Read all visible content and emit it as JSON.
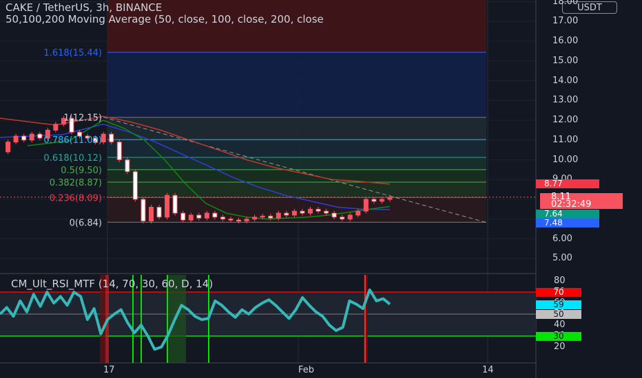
{
  "header": {
    "symbol_line": "CAKE / TetherUS, 3h, BINANCE",
    "indicator_line": "50,100,200 Moving Average (50, close, 100, close, 200, close"
  },
  "currency_button": "USDT",
  "price_axis": {
    "labels": [
      "18.00",
      "17.00",
      "16.00",
      "15.00",
      "14.00",
      "13.00",
      "12.00",
      "11.00",
      "10.00",
      "9.00",
      "8.00",
      "7.00",
      "6.00",
      "5.00"
    ],
    "tags": [
      {
        "text": "8.77",
        "bg": "#f23645",
        "color": "#ffffff"
      },
      {
        "text": "8.11",
        "bg": "#f7525f",
        "color": "#ffffff"
      },
      {
        "text": "02:32:49",
        "bg": "#f7525f",
        "color": "#ffffff"
      },
      {
        "text": "7.64",
        "bg": "#089981",
        "color": "#ffffff"
      },
      {
        "text": "7.48",
        "bg": "#2962ff",
        "color": "#ffffff"
      }
    ]
  },
  "fib_labels": [
    "1.618(15.44)",
    "1(12.15)",
    "0.786(11.02)",
    "0.618(10.12)",
    "0.5(9.50)",
    "0.382(8.87)",
    "0.236(8.09)",
    "0(6.84)"
  ],
  "rsi": {
    "title": "CM_Ult_RSI_MTF (14, 70, 30, 60, D, 14)",
    "axis_labels": [
      "80",
      "70",
      "60",
      "50",
      "40",
      "30",
      "20"
    ],
    "tags": [
      {
        "text": "70",
        "bg": "#ff0000",
        "color": "#ffffff"
      },
      {
        "text": "59",
        "bg": "#00e5ff",
        "color": "#131722"
      },
      {
        "text": "50",
        "bg": "#c0c0c0",
        "color": "#131722"
      },
      {
        "text": "30",
        "bg": "#00e600",
        "color": "#131722"
      }
    ]
  },
  "time_axis": {
    "labels": [
      "17",
      "Feb",
      "14"
    ]
  },
  "colors": {
    "background": "#131722",
    "up": "#f7525f",
    "ma50": "#0e8a0e",
    "ma100": "#2f3fd6",
    "ma200": "#c0392b",
    "rsi_line": "#35b8b8"
  },
  "chart_data": [
    {
      "type": "line",
      "title": "CAKE / TetherUS, 3h, BINANCE",
      "ylim": [
        5.0,
        18.0
      ],
      "x": [
        "17",
        "Feb",
        "14"
      ],
      "series": [
        {
          "name": "Price",
          "values": [
            12.0,
            11.5,
            11.3,
            11.0,
            10.2,
            9.4,
            7.3,
            7.0,
            6.95,
            6.9,
            7.05,
            7.05,
            7.3,
            7.0,
            7.4,
            8.1,
            8.11
          ]
        },
        {
          "name": "MA 50",
          "values": [
            12.0,
            11.6,
            11.0,
            10.0,
            8.8,
            7.8,
            7.3,
            7.1,
            7.0,
            7.05,
            7.1,
            7.2,
            7.35,
            7.5,
            7.64
          ]
        },
        {
          "name": "MA 100",
          "values": [
            11.8,
            11.4,
            10.9,
            10.3,
            9.7,
            9.1,
            8.6,
            8.2,
            7.9,
            7.6,
            7.5,
            7.48
          ]
        },
        {
          "name": "MA 200",
          "values": [
            12.2,
            11.9,
            11.5,
            11.0,
            10.5,
            10.0,
            9.6,
            9.3,
            9.0,
            8.9,
            8.77
          ]
        }
      ],
      "fib_levels": [
        {
          "ratio": "1.618",
          "value": 15.44
        },
        {
          "ratio": "1",
          "value": 12.15
        },
        {
          "ratio": "0.786",
          "value": 11.02
        },
        {
          "ratio": "0.618",
          "value": 10.12
        },
        {
          "ratio": "0.5",
          "value": 9.5
        },
        {
          "ratio": "0.382",
          "value": 8.87
        },
        {
          "ratio": "0.236",
          "value": 8.09
        },
        {
          "ratio": "0",
          "value": 6.84
        }
      ],
      "grid": true
    },
    {
      "type": "line",
      "title": "CM_Ult_RSI_MTF (14, 70, 30, 60, D, 14)",
      "ylim": [
        15,
        85
      ],
      "levels": [
        70,
        50,
        30
      ],
      "series": [
        {
          "name": "RSI",
          "values": [
            50,
            56,
            48,
            62,
            52,
            68,
            57,
            70,
            60,
            66,
            58,
            70,
            66,
            45,
            55,
            32,
            45,
            50,
            54,
            42,
            33,
            40,
            30,
            18,
            20,
            31,
            45,
            58,
            54,
            48,
            45,
            46,
            62,
            58,
            52,
            47,
            54,
            50,
            56,
            60,
            63,
            58,
            52,
            46,
            54,
            65,
            58,
            52,
            48,
            40,
            35,
            38,
            62,
            59,
            55,
            72,
            62,
            64,
            59
          ]
        }
      ]
    }
  ]
}
